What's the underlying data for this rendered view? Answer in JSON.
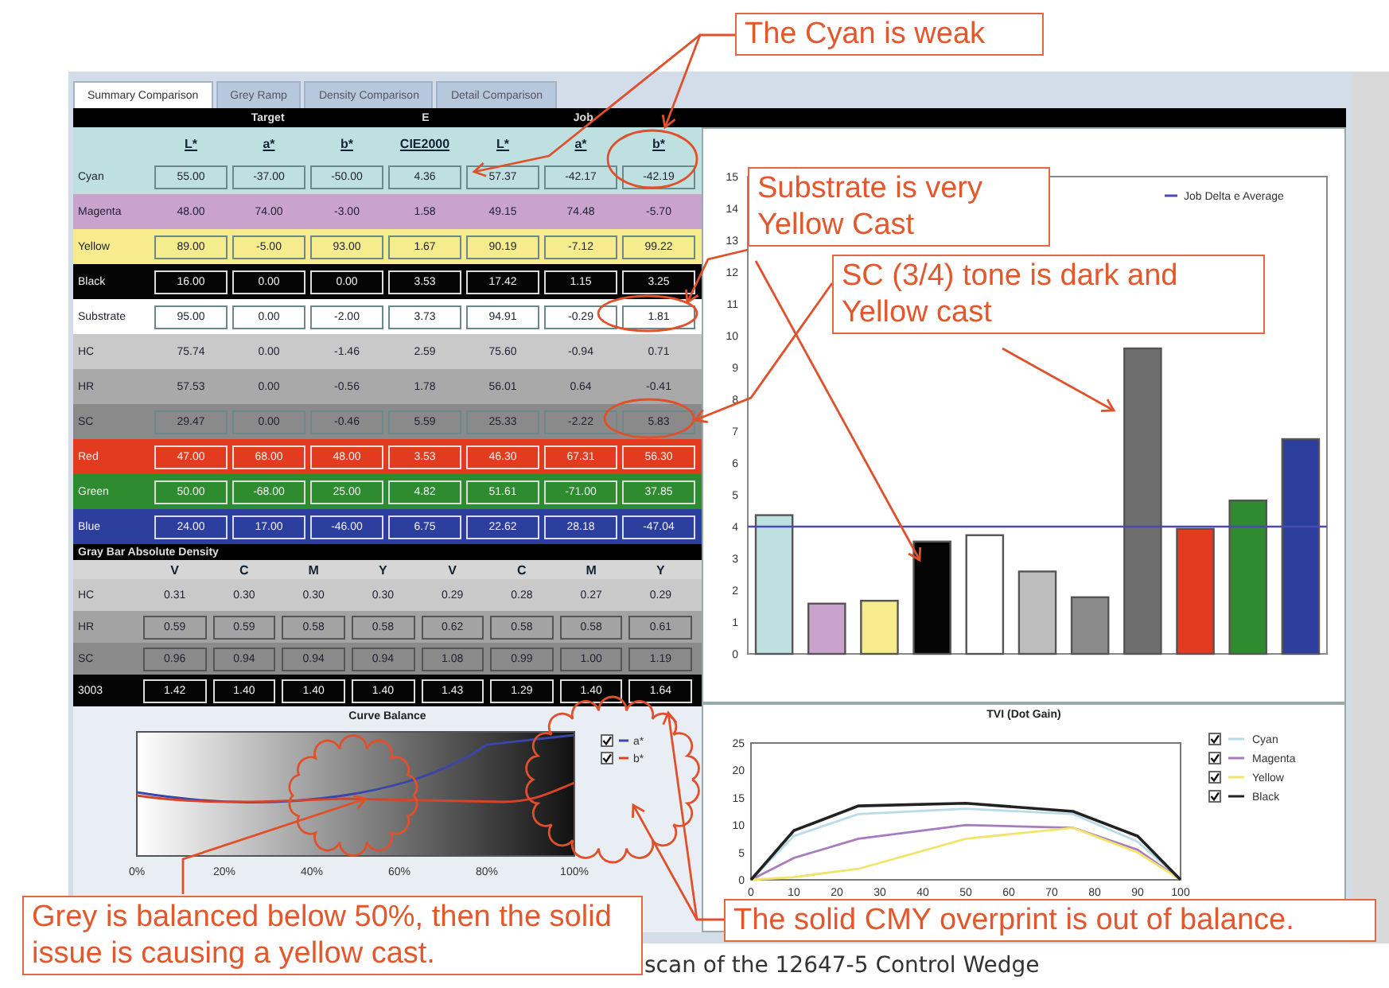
{
  "tabs": [
    {
      "label": "Summary Comparison",
      "selected": true
    },
    {
      "label": "Grey Ramp",
      "selected": false
    },
    {
      "label": "Density Comparison",
      "selected": false
    },
    {
      "label": "Detail Comparison",
      "selected": false
    }
  ],
  "summary_table": {
    "groups": [
      "Target",
      "E",
      "Job"
    ],
    "columns": [
      "L*",
      "a*",
      "b*",
      "CIE2000",
      "L*",
      "a*",
      "b*"
    ],
    "rows": [
      {
        "name": "Cyan",
        "color": "#bfe0e0",
        "boxed": true,
        "values": [
          "55.00",
          "-37.00",
          "-50.00",
          "4.36",
          "57.37",
          "-42.17",
          "-42.19"
        ]
      },
      {
        "name": "Magenta",
        "color": "#caa3cd",
        "boxed": false,
        "values": [
          "48.00",
          "74.00",
          "-3.00",
          "1.58",
          "49.15",
          "74.48",
          "-5.70"
        ]
      },
      {
        "name": "Yellow",
        "color": "#f6ec8e",
        "boxed": true,
        "values": [
          "89.00",
          "-5.00",
          "93.00",
          "1.67",
          "90.19",
          "-7.12",
          "99.22"
        ]
      },
      {
        "name": "Black",
        "color": "#050505",
        "boxed": true,
        "values": [
          "16.00",
          "0.00",
          "0.00",
          "3.53",
          "17.42",
          "1.15",
          "3.25"
        ]
      },
      {
        "name": "Substrate",
        "color": "#ffffff",
        "boxed": true,
        "values": [
          "95.00",
          "0.00",
          "-2.00",
          "3.73",
          "94.91",
          "-0.29",
          "1.81"
        ]
      },
      {
        "name": "HC",
        "color": "#c9c9c9",
        "boxed": false,
        "values": [
          "75.74",
          "0.00",
          "-1.46",
          "2.59",
          "75.60",
          "-0.94",
          "0.71"
        ]
      },
      {
        "name": "HR",
        "color": "#a9a9a9",
        "boxed": false,
        "values": [
          "57.53",
          "0.00",
          "-0.56",
          "1.78",
          "56.01",
          "0.64",
          "-0.41"
        ]
      },
      {
        "name": "SC",
        "color": "#8a8a8a",
        "boxed": true,
        "values": [
          "29.47",
          "0.00",
          "-0.46",
          "5.59",
          "25.33",
          "-2.22",
          "5.83"
        ]
      },
      {
        "name": "Red",
        "color": "#e23b1f",
        "boxed": true,
        "values": [
          "47.00",
          "68.00",
          "48.00",
          "3.53",
          "46.30",
          "67.31",
          "56.30"
        ]
      },
      {
        "name": "Green",
        "color": "#2e8b30",
        "boxed": true,
        "values": [
          "50.00",
          "-68.00",
          "25.00",
          "4.82",
          "51.61",
          "-71.00",
          "37.85"
        ]
      },
      {
        "name": "Blue",
        "color": "#2c3e9e",
        "boxed": true,
        "values": [
          "24.00",
          "17.00",
          "-46.00",
          "6.75",
          "22.62",
          "28.18",
          "-47.04"
        ]
      }
    ]
  },
  "density_table": {
    "title": "Gray Bar Absolute Density",
    "columns": [
      "V",
      "C",
      "M",
      "Y",
      "V",
      "C",
      "M",
      "Y"
    ],
    "rows": [
      {
        "name": "HC",
        "color": "#c9c9c9",
        "boxed": false,
        "values": [
          "0.31",
          "0.30",
          "0.30",
          "0.30",
          "0.29",
          "0.28",
          "0.27",
          "0.29"
        ]
      },
      {
        "name": "HR",
        "color": "#a3a3a3",
        "boxed": true,
        "values": [
          "0.59",
          "0.59",
          "0.58",
          "0.58",
          "0.62",
          "0.58",
          "0.58",
          "0.61"
        ]
      },
      {
        "name": "SC",
        "color": "#8a8a8a",
        "boxed": true,
        "values": [
          "0.96",
          "0.94",
          "0.94",
          "0.94",
          "1.08",
          "0.99",
          "1.00",
          "1.19"
        ]
      },
      {
        "name": "3003",
        "color": "#050505",
        "boxed": true,
        "values": [
          "1.42",
          "1.40",
          "1.40",
          "1.40",
          "1.43",
          "1.29",
          "1.40",
          "1.64"
        ]
      }
    ]
  },
  "curve_balance": {
    "title": "Curve Balance",
    "x_labels": [
      "0%",
      "20%",
      "40%",
      "60%",
      "80%",
      "100%"
    ],
    "legend": [
      {
        "label": "a*",
        "checked": true,
        "color": "#3a46a8"
      },
      {
        "label": "b*",
        "checked": true,
        "color": "#d8442a"
      }
    ]
  },
  "delta_chart": {
    "chart_data": {
      "type": "bar",
      "ylim": [
        0,
        15
      ],
      "yticks": [
        0,
        1,
        2,
        3,
        4,
        5,
        6,
        7,
        8,
        9,
        10,
        11,
        12,
        13,
        14,
        15
      ],
      "values": [
        4.36,
        1.58,
        1.67,
        3.53,
        3.73,
        2.59,
        1.78,
        9.6,
        3.93,
        4.82,
        6.75
      ],
      "colors": [
        "#bfe0e0",
        "#caa3cd",
        "#f6ec8e",
        "#050505",
        "#ffffff",
        "#bdbdbd",
        "#8a8a8a",
        "#6e6e6e",
        "#e23b1f",
        "#2e8b30",
        "#2c3e9e"
      ],
      "ref_lines": [
        {
          "axis": "y",
          "value": 4,
          "label": "Job Delta e Average",
          "color": "#4a4ab0"
        }
      ]
    }
  },
  "tvi_chart": {
    "chart_data": {
      "type": "line",
      "title": "TVI (Dot Gain)",
      "x": [
        0,
        10,
        25,
        50,
        75,
        90,
        100
      ],
      "xlim": [
        0,
        100
      ],
      "ylim": [
        0,
        25
      ],
      "xticks": [
        0,
        10,
        20,
        30,
        40,
        50,
        60,
        70,
        80,
        90,
        100
      ],
      "yticks": [
        0,
        5,
        10,
        15,
        20,
        25
      ],
      "legend": "right",
      "series": [
        {
          "name": "Cyan",
          "color": "#b8dde8",
          "values": [
            0,
            8,
            12,
            13,
            12,
            7,
            0
          ]
        },
        {
          "name": "Magenta",
          "color": "#a77bc0",
          "values": [
            0,
            4,
            7.5,
            10,
            9.5,
            5.5,
            0
          ]
        },
        {
          "name": "Yellow",
          "color": "#f2e46a",
          "values": [
            0,
            0.5,
            2,
            7.5,
            9.5,
            5,
            0
          ]
        },
        {
          "name": "Black",
          "color": "#222222",
          "values": [
            0,
            9,
            13.5,
            14,
            12.5,
            8,
            0
          ]
        }
      ]
    },
    "legend_checked": [
      true,
      true,
      true,
      true
    ]
  },
  "callouts": [
    {
      "text": "The Cyan is weak"
    },
    {
      "text": "Substrate is very Yellow Cast"
    },
    {
      "text": "SC (3/4) tone is dark and Yellow cast"
    },
    {
      "text": "Grey is balanced below 50%, then the solid issue is causing a yellow cast."
    },
    {
      "text": "The solid CMY overprint is out of balance."
    }
  ],
  "caption": "scan of the 12647-5 Control Wedge"
}
